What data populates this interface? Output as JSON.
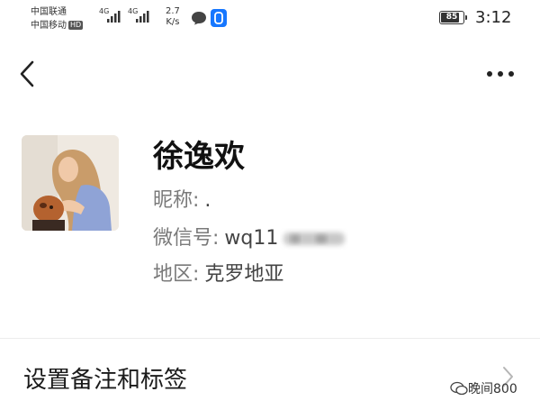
{
  "status_bar": {
    "carrier_1": "中国联通",
    "carrier_2": "中国移动",
    "hd_badge": "HD",
    "network_1": "4G",
    "network_2": "4G",
    "net_speed_value": "2.7",
    "net_speed_unit": "K/s",
    "battery": "85",
    "battery_level": 0.85,
    "time": "3:12"
  },
  "profile": {
    "name": "徐逸欢",
    "nickname_label": "昵称:",
    "nickname_value": ".",
    "wechat_id_label": "微信号:",
    "wechat_id_visible": "wq11",
    "region_label": "地区:",
    "region_value": "克罗地亚"
  },
  "menu": {
    "remark_label": "设置备注和标签"
  },
  "watermark": {
    "text": "晚间800"
  },
  "icons": [
    "back-icon",
    "more-icon",
    "message-icon",
    "app-icon",
    "chevron-right-icon",
    "wechat-logo-icon"
  ],
  "colors": {
    "status_blue": "#1677ff",
    "muted_text": "#7a7a7a"
  }
}
